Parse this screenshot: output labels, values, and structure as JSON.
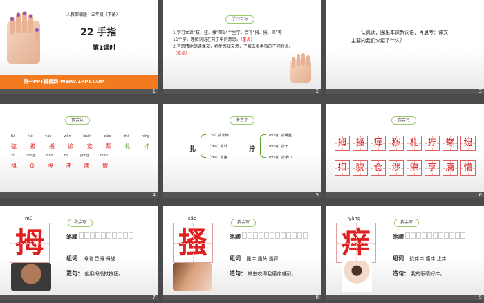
{
  "slides": [
    {
      "number": "1",
      "series": "人教部编版 · 五年级（下册）",
      "title": "22 手指",
      "subtitle": "第1课时",
      "footer": "第一PPT模板网-WWW.1PPT.COM",
      "colors": {
        "footer_bg": "#f47a1f"
      }
    },
    {
      "number": "2",
      "pill": "学习目标",
      "line1": "1.学习本课“拔、扭、搔”等14个生字，会写“拇、搔、痒”等",
      "line2": "16个字，理解词语在句子中的意思。",
      "line2_key": "（重点）",
      "line3": "2.有感情地朗读课文，初步感知文意，了解五根手指的不同特点。",
      "line4_key": "（难点）"
    },
    {
      "number": "3",
      "line1": "认真读，圈出本课新词语，再思考：课文",
      "line2": "主要向我们介绍了什么？"
    },
    {
      "number": "4",
      "pill": "我会认",
      "row1_pinyin": [
        "bá",
        "niǔ",
        "yáo",
        "wān",
        "kuān",
        "piào",
        "zhā",
        "nǐng"
      ],
      "row1_chars": [
        "弦",
        "拔",
        "摇",
        "谚",
        "宽",
        "颓",
        "札",
        "拧"
      ],
      "row2_pinyin": [
        "zǔ",
        "cāng",
        "báo",
        "fèi",
        "yōng",
        "mèn"
      ],
      "row2_chars": [
        "组",
        "仓",
        "薄",
        "沸",
        "庸",
        "懵"
      ]
    },
    {
      "number": "5",
      "pill": "多音字",
      "left_char": "扎",
      "left_items": [
        "（zā）扎小辫",
        "（zhā）扎针",
        "（zhá）扎挣"
      ],
      "right_char": "拧",
      "right_items": [
        "（nǐng）拧螺丝",
        "（níng）拧干",
        "（nìng）拧手巾"
      ]
    },
    {
      "number": "6",
      "pill": "我会写",
      "row1": [
        "拇",
        "搔",
        "痒",
        "秽",
        "札",
        "拧",
        "螺",
        "纽"
      ],
      "row2": [
        "扣",
        "貌",
        "仓",
        "涉",
        "沸",
        "享",
        "庸",
        "懵"
      ]
    },
    {
      "number": "7",
      "pinyin": "mǔ",
      "char": "拇",
      "pill": "我会写",
      "order_label": "笔顺",
      "words_label": "组词",
      "words": "拇指  巨拇  拇战",
      "sentence_label": "造句：",
      "sentence": "他用拇指揿按钮。"
    },
    {
      "number": "8",
      "pinyin": "sāo",
      "char": "搔",
      "pill": "我会写",
      "order_label": "笔顺",
      "words_label": "组词",
      "words": "搔痒  搔头  搔背",
      "sentence_label": "造句：",
      "sentence": "蚊虫咬得我瘙痒难耐。"
    },
    {
      "number": "9",
      "pinyin": "yǎng",
      "char": "痒",
      "pill": "我会写",
      "order_label": "笔顺",
      "words_label": "组词",
      "words": "挠痒痒  瘙痒  止痒",
      "sentence_label": "造句：",
      "sentence": "我的眼睛好痒。"
    }
  ]
}
